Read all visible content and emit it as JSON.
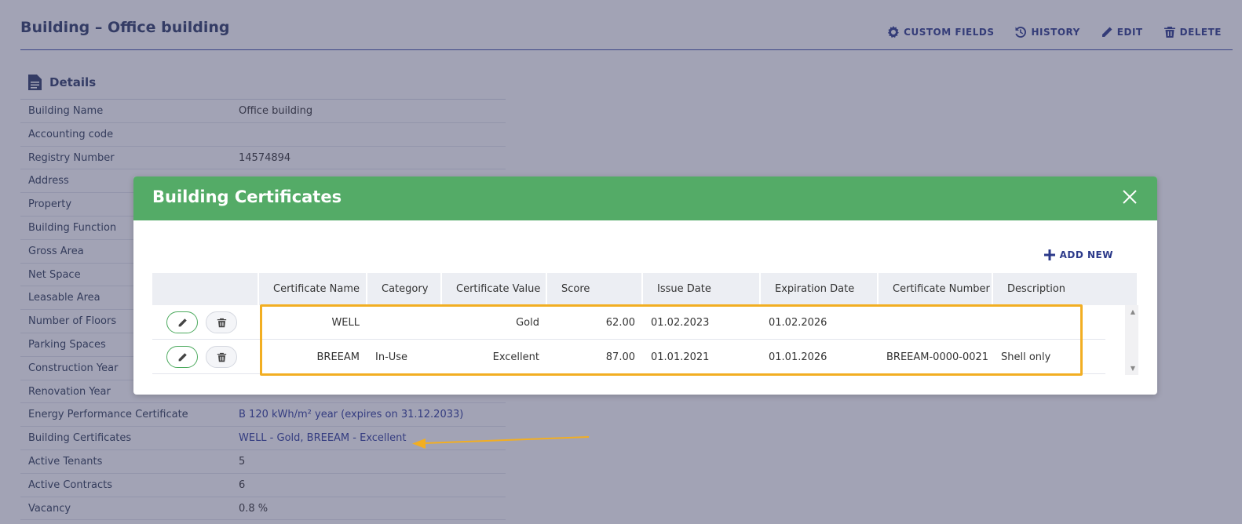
{
  "page": {
    "title": "Building – Office building",
    "actions": [
      {
        "label": "CUSTOM FIELDS",
        "icon": "gear-icon"
      },
      {
        "label": "HISTORY",
        "icon": "history-icon"
      },
      {
        "label": "EDIT",
        "icon": "pencil-icon"
      },
      {
        "label": "DELETE",
        "icon": "trash-icon"
      }
    ]
  },
  "details": {
    "heading": "Details",
    "rows": [
      {
        "label": "Building Name",
        "value": "Office building"
      },
      {
        "label": "Accounting code",
        "value": ""
      },
      {
        "label": "Registry Number",
        "value": "14574894"
      },
      {
        "label": "Address",
        "value": ""
      },
      {
        "label": "Property",
        "value": ""
      },
      {
        "label": "Building Function",
        "value": ""
      },
      {
        "label": "Gross Area",
        "value": ""
      },
      {
        "label": "Net Space",
        "value": ""
      },
      {
        "label": "Leasable Area",
        "value": ""
      },
      {
        "label": "Number of Floors",
        "value": ""
      },
      {
        "label": "Parking Spaces",
        "value": ""
      },
      {
        "label": "Construction Year",
        "value": ""
      },
      {
        "label": "Renovation Year",
        "value": ""
      },
      {
        "label": "Energy Performance Certificate",
        "value": "B 120 kWh/m² year (expires on 31.12.2033)"
      },
      {
        "label": "Building Certificates",
        "value": "WELL - Gold, BREEAM - Excellent"
      },
      {
        "label": "Active Tenants",
        "value": "5"
      },
      {
        "label": "Active Contracts",
        "value": "6"
      },
      {
        "label": "Vacancy",
        "value": "0.8 %"
      }
    ]
  },
  "modal": {
    "title": "Building Certificates",
    "add_new_label": "ADD NEW",
    "columns": [
      "Certificate Name",
      "Category",
      "Certificate Value",
      "Score",
      "Issue Date",
      "Expiration Date",
      "Certificate Number",
      "Description"
    ],
    "rows": [
      {
        "name": "WELL",
        "category": "",
        "value": "Gold",
        "score": "62.00",
        "issue": "01.02.2023",
        "expiration": "01.02.2026",
        "number": "",
        "description": ""
      },
      {
        "name": "BREEAM",
        "category": "In-Use",
        "value": "Excellent",
        "score": "87.00",
        "issue": "01.01.2021",
        "expiration": "01.01.2026",
        "number": "BREEAM-0000-0021",
        "description": "Shell only"
      }
    ]
  },
  "colors": {
    "modal_header": "#54ab67",
    "highlight": "#f2ae22",
    "accent": "#2c3a8a"
  }
}
